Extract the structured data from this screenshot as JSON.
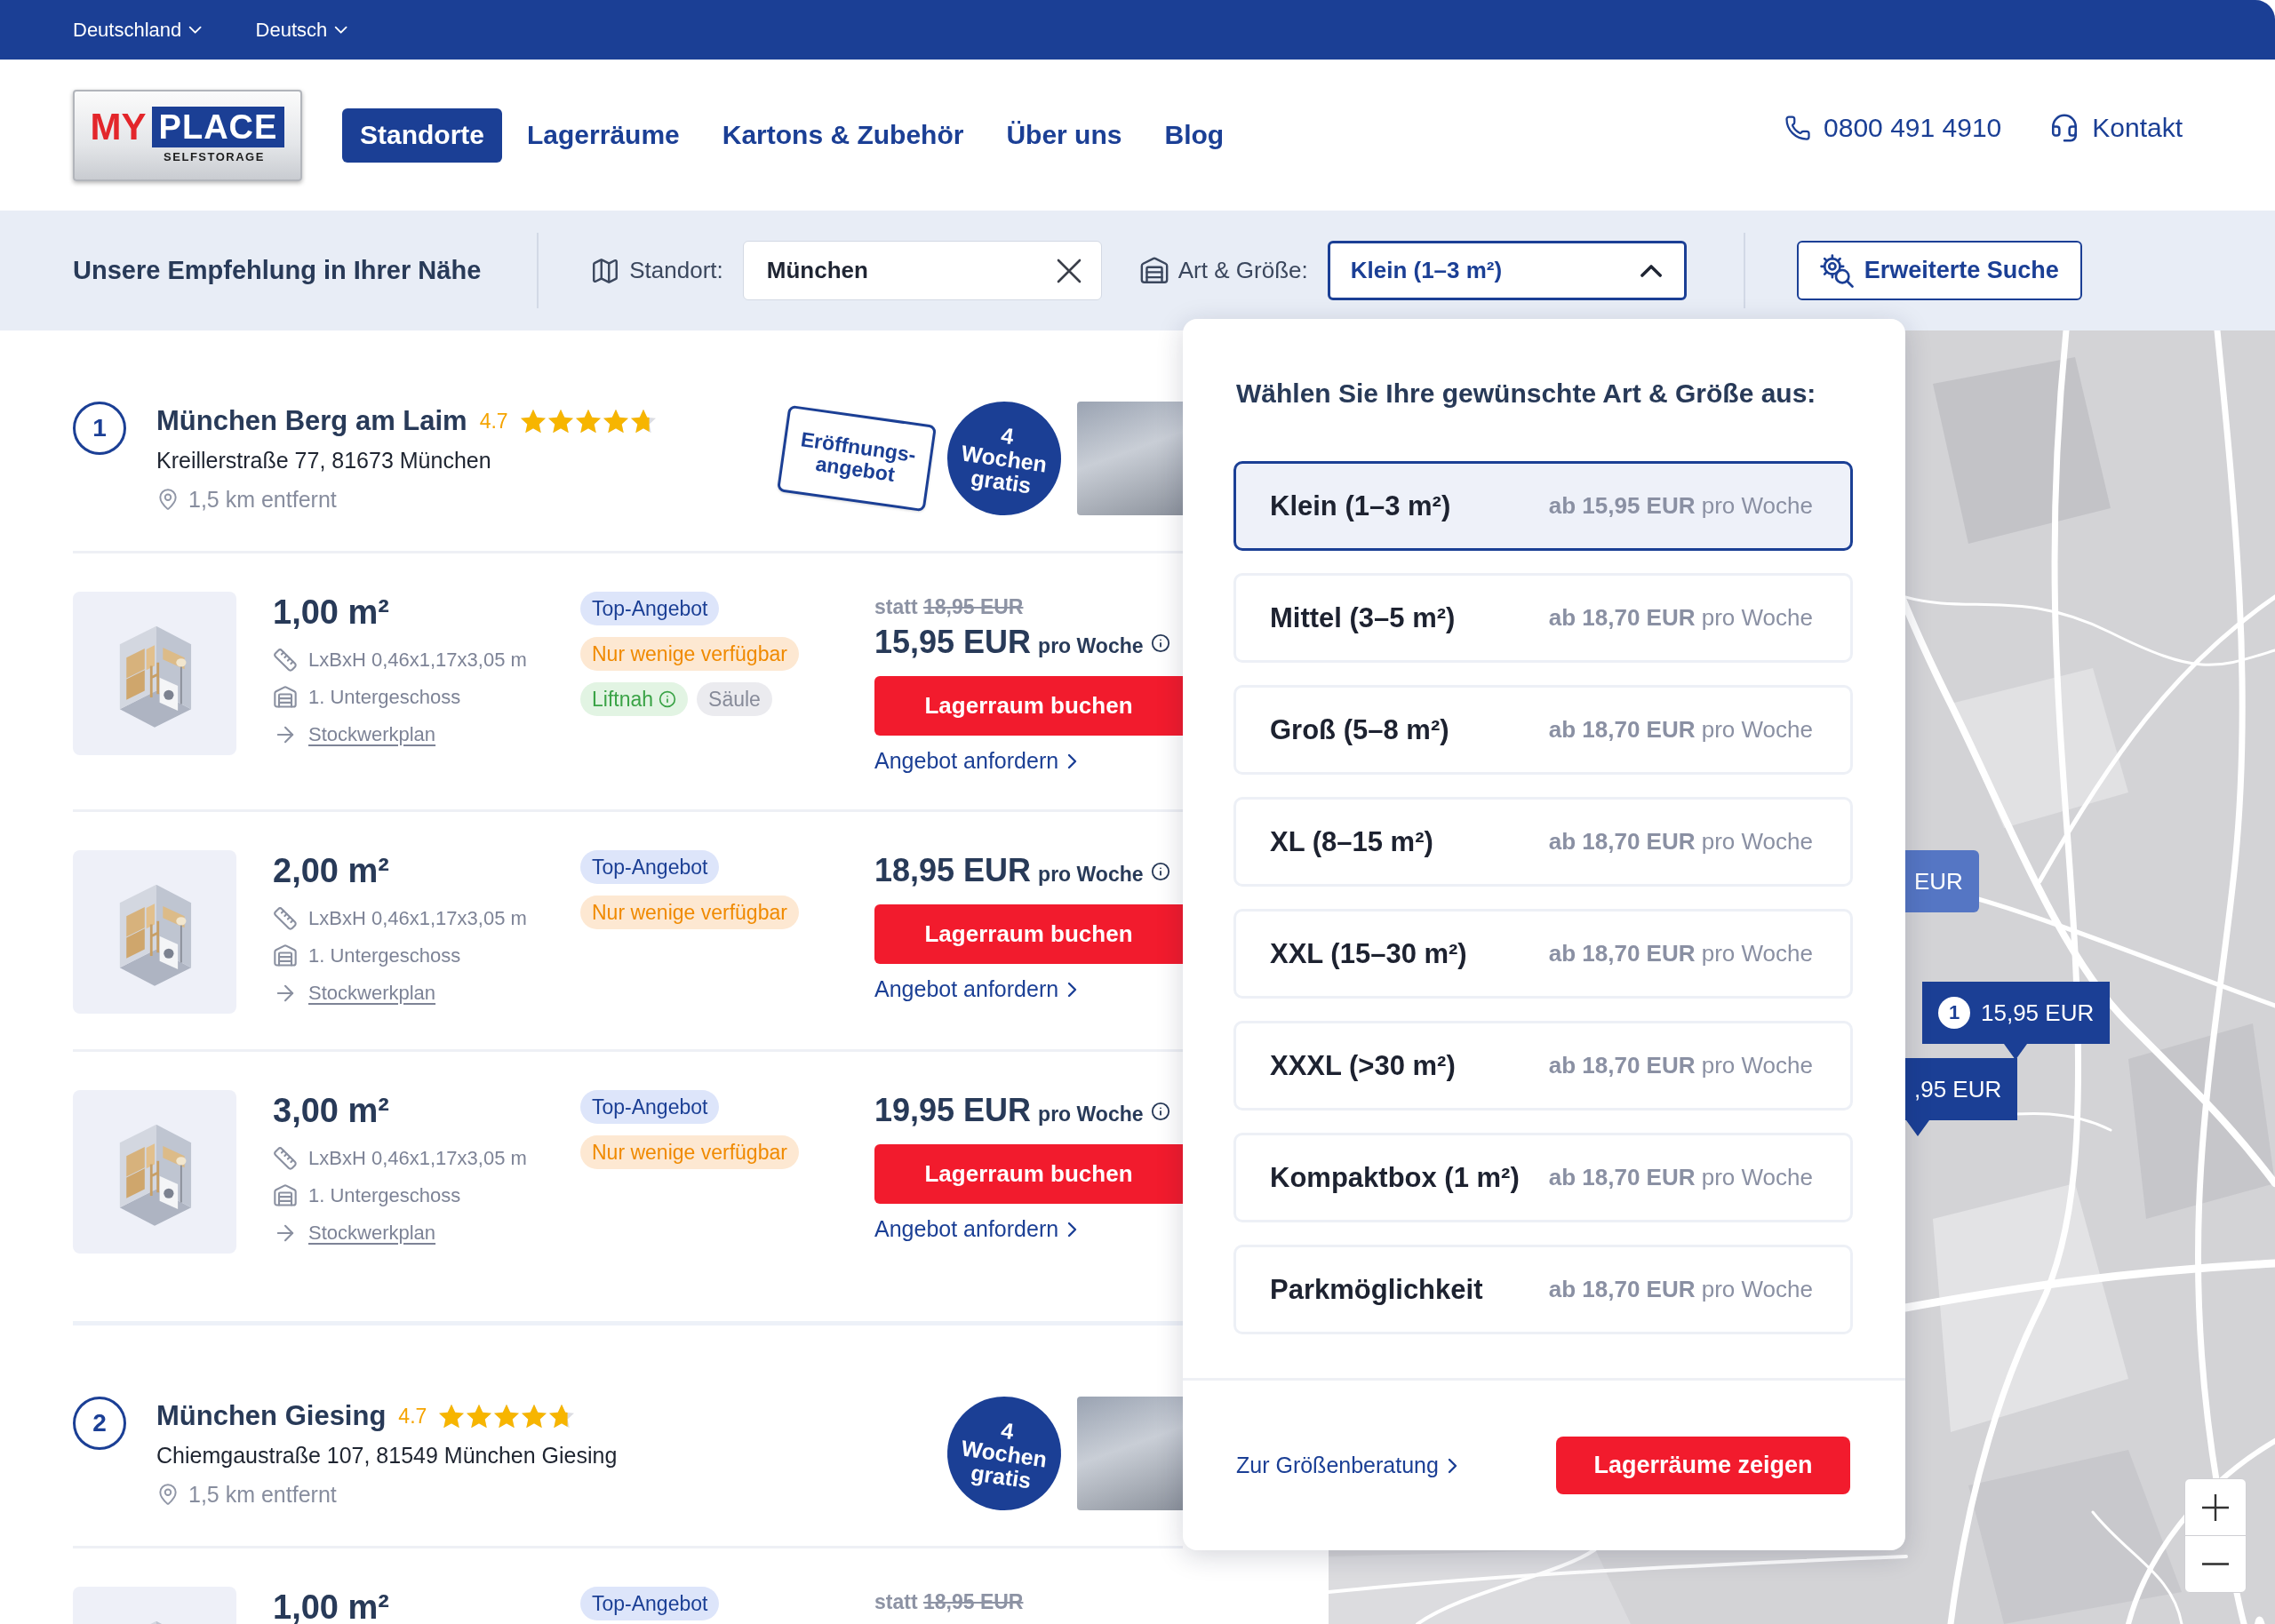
{
  "top_bar": {
    "country": "Deutschland",
    "language": "Deutsch"
  },
  "header": {
    "logo": {
      "word_1": "MY",
      "word_2": "PLACE",
      "tagline": "SELFSTORAGE"
    },
    "nav": [
      {
        "label": "Standorte",
        "selected": true
      },
      {
        "label": "Lagerräume",
        "selected": false
      },
      {
        "label": "Kartons & Zubehör",
        "selected": false
      },
      {
        "label": "Über uns",
        "selected": false
      },
      {
        "label": "Blog",
        "selected": false
      }
    ],
    "phone": "0800 491 4910",
    "contact": "Kontakt"
  },
  "search_bar": {
    "title": "Unsere Empfehlung in Ihrer Nähe",
    "location_field": {
      "label": "Standort:",
      "value": "München"
    },
    "size_field": {
      "label": "Art & Größe:",
      "value": "Klein (1–3 m²)",
      "expanded": true
    },
    "advanced_button": "Erweiterte Suche"
  },
  "locations": [
    {
      "number": "1",
      "name": "München Berg am Laim",
      "rating": "4.7",
      "stars": 4.7,
      "address": "Kreillerstraße 77, 81673 München",
      "distance": "1,5 km entfernt",
      "badges": [
        {
          "kind": "stamp",
          "text": "Eröffnungs-\nangebot"
        },
        {
          "kind": "circle",
          "text": "4\nWochen\ngratis"
        }
      ],
      "units": [
        {
          "size": "1,00 m²",
          "dimensions": "LxBxH 0,46x1,17x3,05 m",
          "floor": "1. Untergeschoss",
          "plan_link": "Stockwerkplan",
          "tags": [
            {
              "kind": "top",
              "text": "Top-Angebot",
              "info": false
            },
            {
              "kind": "scarce",
              "text": "Nur wenige verfügbar",
              "info": false
            },
            {
              "kind": "feature",
              "text": "Liftnah",
              "info": true
            },
            {
              "kind": "neutral",
              "text": "Säule",
              "info": false
            }
          ],
          "old_price": {
            "prefix": "statt",
            "amount": "18,95 EUR"
          },
          "price": "15,95 EUR",
          "price_unit": "pro Woche",
          "book_button": "Lagerraum buchen",
          "offer_link": "Angebot anfordern"
        },
        {
          "size": "2,00 m²",
          "dimensions": "LxBxH 0,46x1,17x3,05 m",
          "floor": "1. Untergeschoss",
          "plan_link": "Stockwerkplan",
          "tags": [
            {
              "kind": "top",
              "text": "Top-Angebot",
              "info": false
            },
            {
              "kind": "scarce",
              "text": "Nur wenige verfügbar",
              "info": false
            }
          ],
          "price": "18,95 EUR",
          "price_unit": "pro Woche",
          "book_button": "Lagerraum buchen",
          "offer_link": "Angebot anfordern"
        },
        {
          "size": "3,00 m²",
          "dimensions": "LxBxH 0,46x1,17x3,05 m",
          "floor": "1. Untergeschoss",
          "plan_link": "Stockwerkplan",
          "tags": [
            {
              "kind": "top",
              "text": "Top-Angebot",
              "info": false
            },
            {
              "kind": "scarce",
              "text": "Nur wenige verfügbar",
              "info": false
            }
          ],
          "price": "19,95 EUR",
          "price_unit": "pro Woche",
          "book_button": "Lagerraum buchen",
          "offer_link": "Angebot anfordern"
        }
      ]
    },
    {
      "number": "2",
      "name": "München Giesing",
      "rating": "4.7",
      "stars": 4.7,
      "address": "Chiemgaustraße 107, 81549 München Giesing",
      "distance": "1,5 km entfernt",
      "badges": [
        {
          "kind": "circle",
          "text": "4\nWochen\ngratis"
        }
      ],
      "units": [
        {
          "size": "1,00 m²",
          "tags": [
            {
              "kind": "top",
              "text": "Top-Angebot",
              "info": false
            }
          ],
          "old_price": {
            "prefix": "statt",
            "amount": "18,95 EUR"
          }
        }
      ]
    }
  ],
  "size_menu": {
    "title": "Wählen Sie Ihre gewünschte Art & Größe aus:",
    "options": [
      {
        "label": "Klein (1–3 m²)",
        "price": "**ab 15,95 EUR** pro Woche",
        "selected": true
      },
      {
        "label": "Mittel (3–5 m²)",
        "price": "**ab 18,70 EUR** pro Woche",
        "selected": false
      },
      {
        "label": "Groß (5–8 m²)",
        "price": "**ab 18,70 EUR** pro Woche",
        "selected": false
      },
      {
        "label": "XL (8–15 m²)",
        "price": "**ab 18,70 EUR** pro Woche",
        "selected": false
      },
      {
        "label": "XXL (15–30 m²)",
        "price": "**ab 18,70 EUR** pro Woche",
        "selected": false
      },
      {
        "label": "XXXL (>30 m²)",
        "price": "**ab 18,70 EUR** pro Woche",
        "selected": false
      },
      {
        "label": "Kompaktbox (1 m²)",
        "price": "**ab 18,70 EUR** pro Woche",
        "selected": false
      },
      {
        "label": "Parkmöglichkeit",
        "price": "**ab 18,70 EUR** pro Woche",
        "selected": false
      }
    ],
    "advice_link": "Zur Größenberatung",
    "show_button": "Lagerräume zeigen"
  },
  "map": {
    "markers": [
      {
        "price": "EUR",
        "dimmed": true
      },
      {
        "number": "1",
        "price": "15,95 EUR",
        "dimmed": false
      },
      {
        "price": ",95 EUR",
        "dimmed": false
      }
    ]
  }
}
